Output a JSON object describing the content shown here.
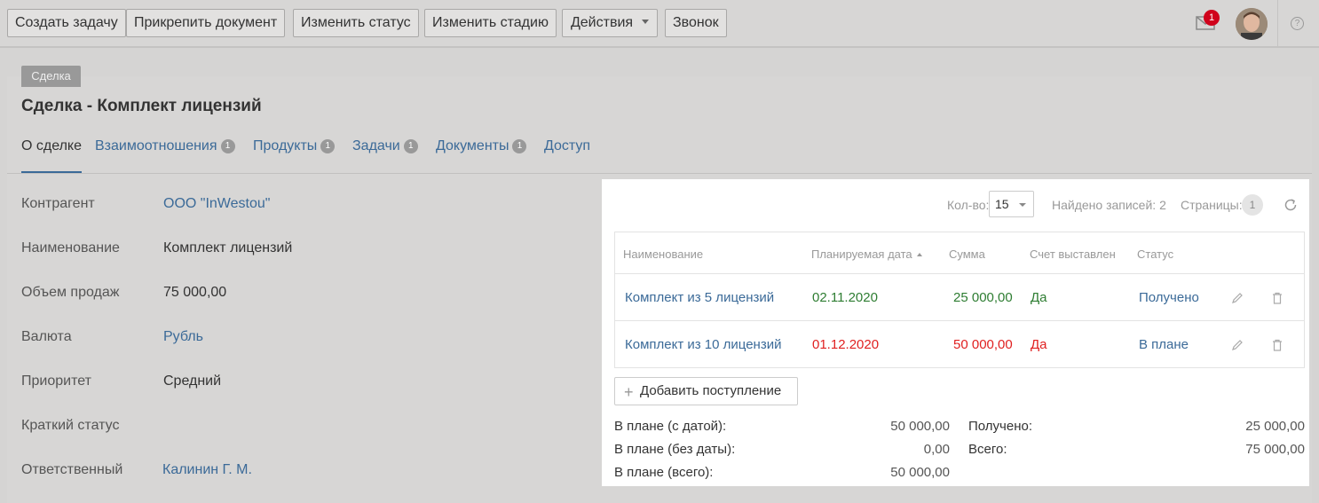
{
  "toolbar": {
    "create_task": "Создать задачу",
    "attach_document": "Прикрепить документ",
    "change_status": "Изменить статус",
    "change_stage": "Изменить стадию",
    "actions": "Действия",
    "call": "Звонок",
    "mail_count": "1",
    "help": "?"
  },
  "card": {
    "type_tag": "Сделка",
    "title": "Сделка - Комплект лицензий"
  },
  "tabs": [
    {
      "label": "О сделке",
      "count": null
    },
    {
      "label": "Взаимоотношения",
      "count": "1"
    },
    {
      "label": "Продукты",
      "count": "1"
    },
    {
      "label": "Задачи",
      "count": "1"
    },
    {
      "label": "Документы",
      "count": "1"
    },
    {
      "label": "Доступ",
      "count": null
    }
  ],
  "fields": [
    {
      "label": "Контрагент",
      "value": "ООО \"InWestou\""
    },
    {
      "label": "Наименование",
      "value": "Комплект лицензий"
    },
    {
      "label": "Объем продаж",
      "value": "75 000,00"
    },
    {
      "label": "Валюта",
      "value": "Рубль"
    },
    {
      "label": "Приоритет",
      "value": "Средний"
    },
    {
      "label": "Краткий статус",
      "value": ""
    },
    {
      "label": "Ответственный",
      "value": "Калинин Г. М."
    }
  ],
  "payments": {
    "qty_label": "Кол-во:",
    "qty_value": "15",
    "found": "Найдено записей: 2",
    "pages_label": "Страницы:",
    "page": "1",
    "columns": [
      "Наименование",
      "Планируемая дата",
      "Сумма",
      "Счет выставлен",
      "Статус"
    ],
    "rows": [
      {
        "name": "Комплект из 5 лицензий",
        "date": "02.11.2020",
        "sum": "25 000,00",
        "invoiced": "Да",
        "status": "Получено"
      },
      {
        "name": "Комплект из 10 лицензий",
        "date": "01.12.2020",
        "sum": "50 000,00",
        "invoiced": "Да",
        "status": "В плане"
      }
    ],
    "add_button": "Добавить поступление",
    "totals": {
      "planned_dated_label": "В плане (с датой):",
      "planned_dated_value": "50 000,00",
      "planned_undated_label": "В плане (без даты):",
      "planned_undated_value": "0,00",
      "planned_total_label": "В плане (всего):",
      "planned_total_value": "50 000,00",
      "received_label": "Получено:",
      "received_value": "25 000,00",
      "total_label": "Всего:",
      "total_value": "75 000,00"
    }
  },
  "colors": {
    "link": "#3b6a98",
    "green": "#2e7d32",
    "red": "#e02020",
    "badge": "#d0021b"
  }
}
